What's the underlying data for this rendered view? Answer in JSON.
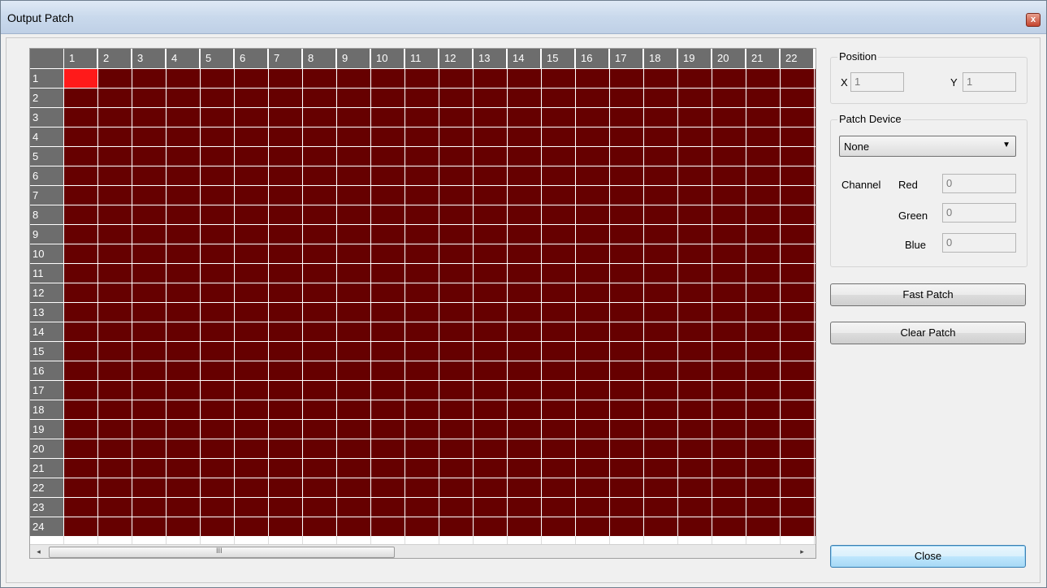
{
  "window": {
    "title": "Output Patch",
    "close_glyph": "x"
  },
  "grid": {
    "columns": [
      "1",
      "2",
      "3",
      "4",
      "5",
      "6",
      "7",
      "8",
      "9",
      "10",
      "11",
      "12",
      "13",
      "14",
      "15",
      "16",
      "17",
      "18",
      "19",
      "20",
      "21",
      "22"
    ],
    "rows": [
      "1",
      "2",
      "3",
      "4",
      "5",
      "6",
      "7",
      "8",
      "9",
      "10",
      "11",
      "12",
      "13",
      "14",
      "15",
      "16",
      "17",
      "18",
      "19",
      "20",
      "21",
      "22",
      "23",
      "24"
    ],
    "selected": {
      "row": "1",
      "col": "1"
    },
    "colors": {
      "cell": "#660000",
      "selected": "#ff1a1a",
      "header": "#6d6d6d"
    }
  },
  "scrollbar": {
    "left_arrow": "◂",
    "right_arrow": "▸",
    "grip": "III"
  },
  "position": {
    "label": "Position",
    "x_label": "X",
    "x_value": "1",
    "y_label": "Y",
    "y_value": "1"
  },
  "patch_device": {
    "label": "Patch Device",
    "selected": "None",
    "channel_label": "Channel",
    "red_label": "Red",
    "red_value": "0",
    "green_label": "Green",
    "green_value": "0",
    "blue_label": "Blue",
    "blue_value": "0"
  },
  "buttons": {
    "fast_patch": "Fast Patch",
    "clear_patch": "Clear Patch",
    "close": "Close"
  }
}
